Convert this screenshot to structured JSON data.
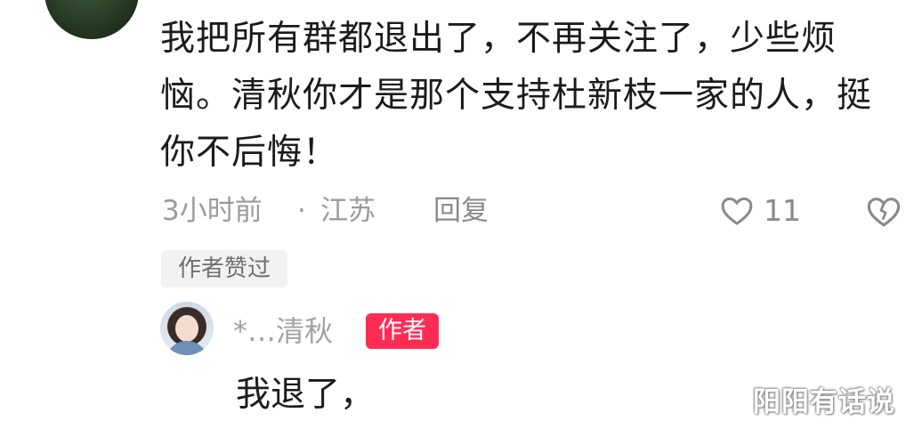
{
  "comment": {
    "text": "我把所有群都退出了，不再关注了，少些烦恼。清秋你才是那个支持杜新枝一家的人，挺你不后悔！",
    "time": "3小时前",
    "separator": "·",
    "location": "江苏",
    "reply_label": "回复",
    "like_count": "11",
    "like_icon": "heart-outline-icon",
    "dislike_icon": "broken-heart-icon",
    "author_liked_tag": "作者赞过"
  },
  "reply": {
    "name": "*…清秋",
    "badge": "作者",
    "badge_color": "#fe2c55",
    "text": "我退了，"
  },
  "watermark": "阳阳有话说"
}
